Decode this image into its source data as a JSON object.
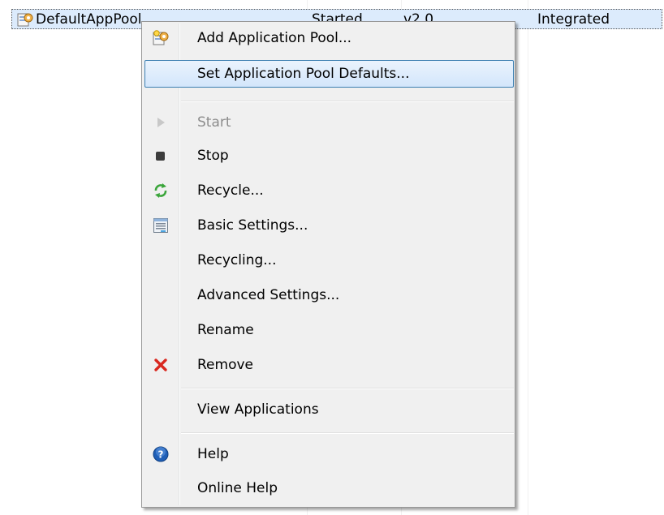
{
  "row": {
    "name": "DefaultAppPool",
    "status": "Started",
    "version": "v2.0",
    "pipeline": "Integrated"
  },
  "menu": {
    "add_app_pool": "Add Application Pool...",
    "set_defaults": "Set Application Pool Defaults...",
    "start": "Start",
    "stop": "Stop",
    "recycle": "Recycle...",
    "basic_settings": "Basic Settings...",
    "recycling": "Recycling...",
    "advanced_settings": "Advanced Settings...",
    "rename": "Rename",
    "remove": "Remove",
    "view_applications": "View Applications",
    "help": "Help",
    "online_help": "Online Help"
  },
  "colors": {
    "selection_border": "#3c7fb1",
    "remove_red": "#d9281f",
    "recycle_green": "#3aa53a",
    "help_blue": "#1f5fb7"
  }
}
